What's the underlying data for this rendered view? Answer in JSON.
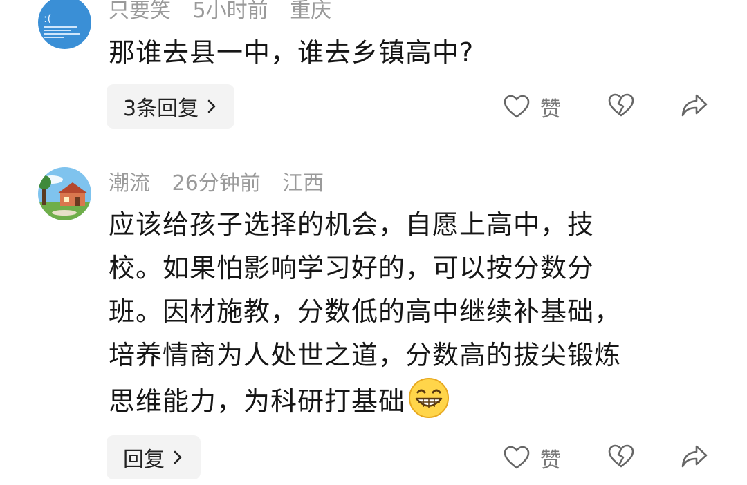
{
  "comments": [
    {
      "username": "只要笑",
      "time": "5小时前",
      "location": "重庆",
      "text": "那谁去县一中，谁去乡镇高中?",
      "reply_label": "3条回复",
      "like_label": "赞",
      "avatar_icon": "blue-screen-avatar"
    },
    {
      "username": "潮流",
      "time": "26分钟前",
      "location": "江西",
      "text_lines": [
        "应该给孩子选择的机会，自愿上高中，技",
        "校。如果怕影响学习好的，可以按分数分",
        "班。因材施教，分数低的高中继续补基础，",
        "培养情商为人处世之道，分数高的拔尖锻炼",
        "思维能力，为科研打基础"
      ],
      "emoji": "grinning-face-emoji",
      "reply_label": "回复",
      "like_label": "赞",
      "avatar_icon": "house-landscape-avatar"
    }
  ],
  "icons": {
    "like": "heart-icon",
    "dislike": "broken-heart-icon",
    "share": "share-arrow-icon",
    "chevron": "chevron-right-icon"
  },
  "colors": {
    "meta_text": "#9a9a9a",
    "button_bg": "#f3f3f3",
    "icon_stroke": "#666666"
  }
}
